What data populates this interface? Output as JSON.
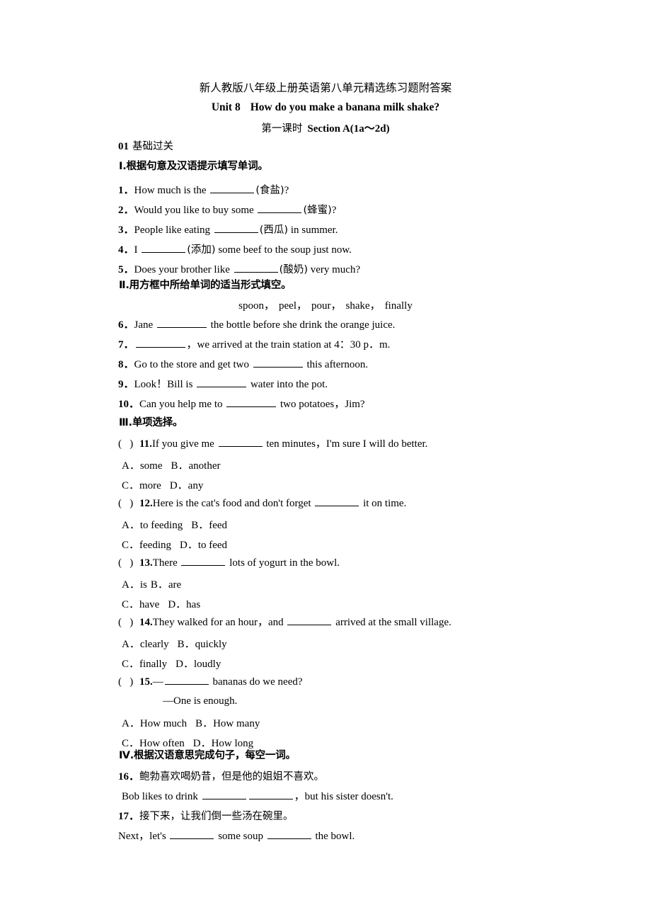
{
  "document": {
    "header_title": "新人教版八年级上册英语第八单元精选练习题附答案",
    "unit_label": "Unit 8",
    "unit_question": "How do you make a banana milk shake?",
    "period_cn": "第一课时",
    "period_en": "Section A(1a～2d)"
  },
  "part01": {
    "number": "01",
    "label": "基础过关"
  },
  "sections": {
    "s1_heading": "Ⅰ.根据句意及汉语提示填写单词。",
    "s2_heading": "Ⅱ.用方框中所给单词的适当形式填空。",
    "s3_heading": "Ⅲ.单项选择。",
    "s4_heading": "Ⅳ.根据汉语意思完成句子，每空一词。"
  },
  "word_bank": {
    "words": [
      "spoon",
      "peel",
      "pour",
      "shake",
      "finally"
    ],
    "separator": "，"
  },
  "fill_in": [
    {
      "num": "1．",
      "pre": "How much is the ",
      "hint": "(食盐)",
      "post": "?"
    },
    {
      "num": "2．",
      "pre": "Would you like to buy some ",
      "hint": "(蜂蜜)",
      "post": "?"
    },
    {
      "num": "3．",
      "pre": "People like eating ",
      "hint": "(西瓜)",
      "post": " in summer."
    },
    {
      "num": "4．",
      "pre": "I ",
      "hint": "(添加)",
      "post": " some beef to the soup just now."
    },
    {
      "num": "5．",
      "pre": "Does your brother like ",
      "hint": "(酸奶)",
      "post": " very much?"
    }
  ],
  "word_form": [
    {
      "num": "6．",
      "pre": "Jane ",
      "post": " the bottle before she drink the orange juice."
    },
    {
      "num": "7．",
      "pre": "",
      "post": "，we arrived at the train station at 4：30 p．m."
    },
    {
      "num": "8．",
      "pre": "Go to the store and get two ",
      "post": " this afternoon."
    },
    {
      "num": "9．",
      "pre": "Look！Bill is ",
      "post": " water into the pot."
    },
    {
      "num": "10．",
      "pre": "Can you help me to ",
      "post": " two potatoes，Jim?"
    }
  ],
  "multiple_choice": [
    {
      "num": "11.",
      "stem_pre": "If you give me ",
      "stem_post": " ten minutes，I'm sure I will do better.",
      "options_row1": [
        "A．some",
        "B．another"
      ],
      "options_row2": [
        "C．more",
        "D．any"
      ]
    },
    {
      "num": "12.",
      "stem_pre": "Here is the cat's food and don't forget ",
      "stem_post": " it on time.",
      "options_row1": [
        "A．to feeding",
        "B．feed"
      ],
      "options_row2": [
        "C．feeding",
        "D．to feed"
      ]
    },
    {
      "num": "13.",
      "stem_pre": "There ",
      "stem_post": " lots of yogurt in the bowl.",
      "options_row1": [
        "A．is",
        "B．are"
      ],
      "options_row2": [
        "C．have",
        "D．has"
      ]
    },
    {
      "num": "14.",
      "stem_pre": "They walked for an hour，and ",
      "stem_post": " arrived at the small village.",
      "options_row1": [
        "A．clearly",
        "B．quickly"
      ],
      "options_row2": [
        "C．finally",
        "D．loudly"
      ]
    },
    {
      "num": "15.",
      "stem_pre": "—",
      "stem_post": " bananas do we need?",
      "answer_line": "—One is enough.",
      "options_row1": [
        "A．How much",
        "B．How many"
      ],
      "options_row2": [
        "C．How often",
        "D．How long"
      ]
    }
  ],
  "translation": [
    {
      "num": "16．",
      "chinese": "鲍勃喜欢喝奶昔，但是他的姐姐不喜欢。",
      "en_pre": "Bob likes to drink ",
      "en_post": "，but his sister doesn't."
    },
    {
      "num": "17．",
      "chinese": "接下来，让我们倒一些汤在碗里。",
      "en_pre": "Next，let's ",
      "en_mid": " some soup ",
      "en_post": " the bowl."
    }
  ]
}
